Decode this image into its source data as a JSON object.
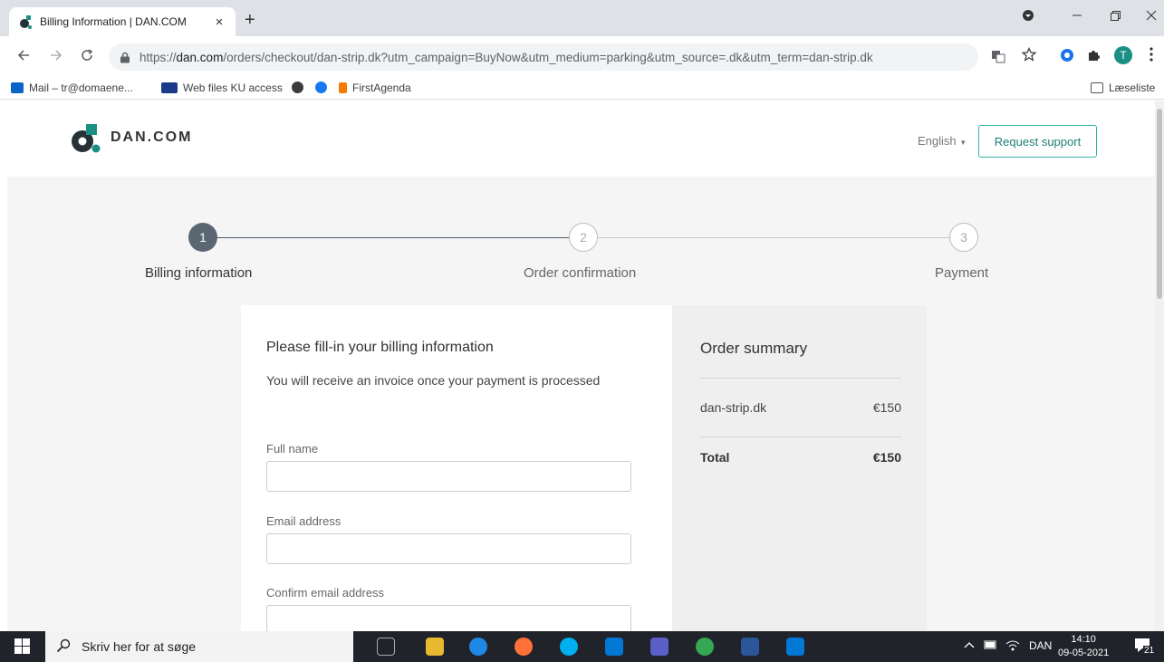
{
  "browser": {
    "tab_title": "Billing Information | DAN.COM",
    "tab_close": "×",
    "new_tab": "+",
    "url_scheme": "https://",
    "url_host": "dan.com",
    "url_path": "/orders/checkout/dan-strip.dk?utm_campaign=BuyNow&utm_medium=parking&utm_source=.dk&utm_term=dan-strip.dk",
    "profile_initial": "T",
    "bookmarks": [
      {
        "label": "Mail – tr@domaene...",
        "color": "#0a64c8"
      },
      {
        "label": "Web files KU access",
        "color": "#1a3a8a"
      },
      {
        "label": "",
        "color": "#3c3c3c"
      },
      {
        "label": "",
        "color": "#1877f2"
      },
      {
        "label": "FirstAgenda",
        "color": "#f57c00"
      }
    ],
    "reading_list": "Læseliste"
  },
  "header": {
    "logo_text": "DAN.COM",
    "language": "English",
    "support_button": "Request support",
    "brand_color": "#1a8f83",
    "dark_color": "#263238"
  },
  "steps": [
    {
      "number": "1",
      "label": "Billing information",
      "active": true
    },
    {
      "number": "2",
      "label": "Order confirmation",
      "active": false
    },
    {
      "number": "3",
      "label": "Payment",
      "active": false
    }
  ],
  "form": {
    "title": "Please fill-in your billing information",
    "subtitle": "You will receive an invoice once your payment is processed",
    "fields": [
      {
        "label": "Full name",
        "value": ""
      },
      {
        "label": "Email address",
        "value": ""
      },
      {
        "label": "Confirm email address",
        "value": ""
      }
    ]
  },
  "summary": {
    "title": "Order summary",
    "item_name": "dan-strip.dk",
    "item_price": "€150",
    "total_label": "Total",
    "total_price": "€150"
  },
  "taskbar": {
    "search_placeholder": "Skriv her for at søge",
    "language": "DAN",
    "time": "14:10",
    "date": "09-05-2021",
    "notifications": "21"
  }
}
